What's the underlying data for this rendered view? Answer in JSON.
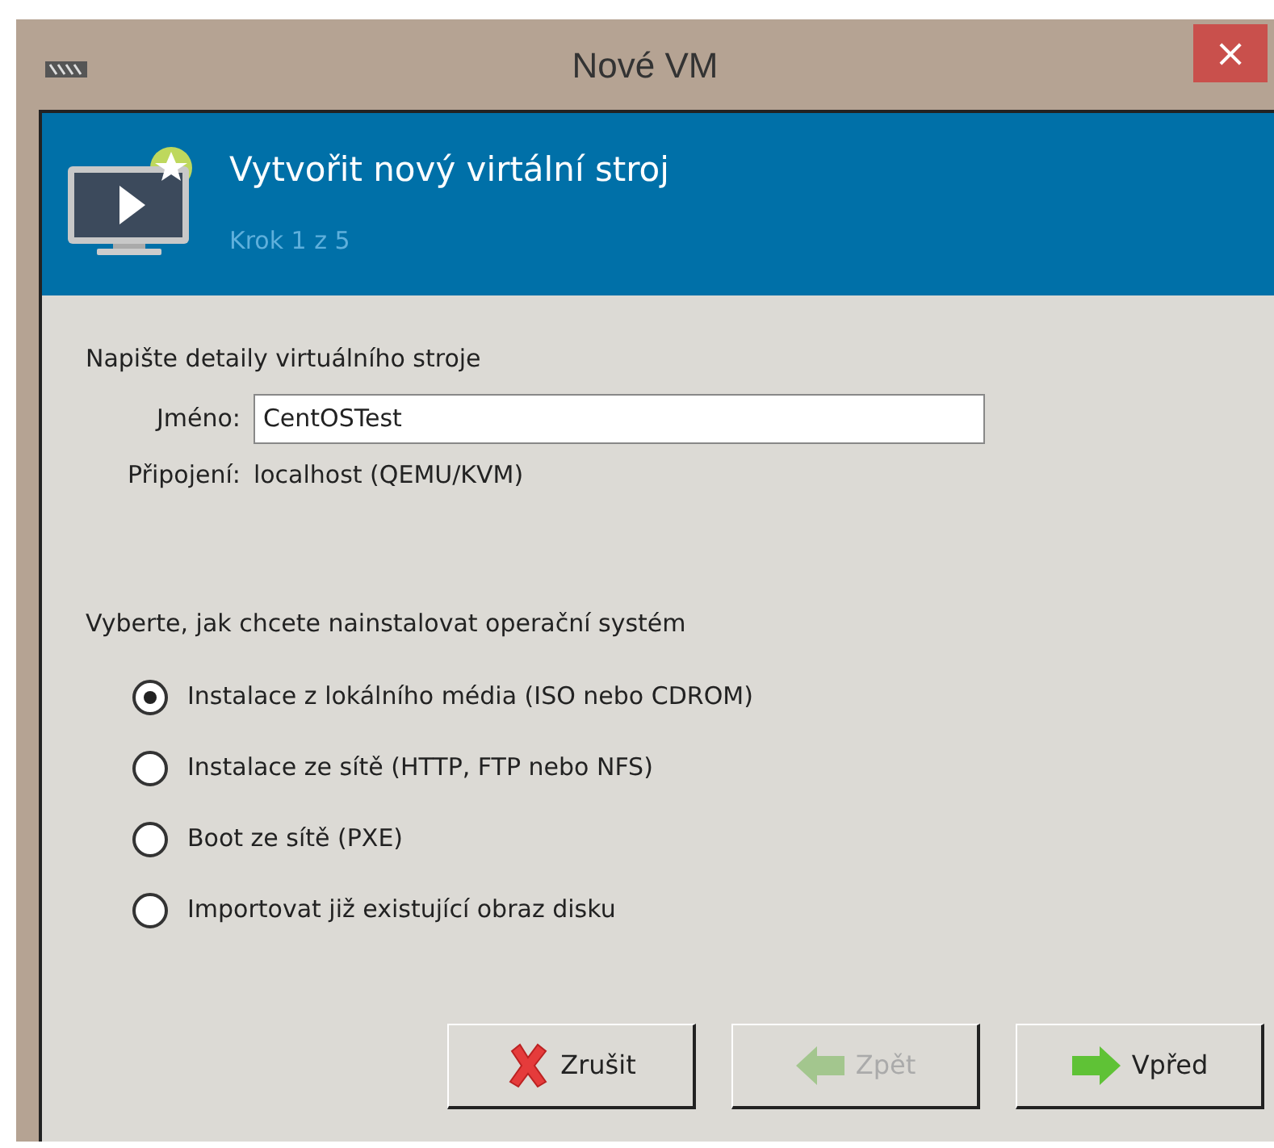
{
  "window": {
    "title": "Nové VM",
    "close": "×"
  },
  "header": {
    "title": "Vytvořit nový virtální stroj",
    "step": "Krok 1 z 5"
  },
  "details": {
    "heading": "Napište detaily virtuálního stroje",
    "name_label": "Jméno:",
    "name_value": "CentOSTest",
    "connection_label": "Připojení:",
    "connection_value": "localhost (QEMU/KVM)"
  },
  "install": {
    "heading": "Vyberte, jak chcete nainstalovat operační systém",
    "options": [
      {
        "label": "Instalace z lokálního média (ISO nebo CDROM)",
        "selected": true
      },
      {
        "label": "Instalace ze sítě (HTTP, FTP nebo NFS)",
        "selected": false
      },
      {
        "label": "Boot ze sítě (PXE)",
        "selected": false
      },
      {
        "label": "Importovat již existující obraz disku",
        "selected": false
      }
    ]
  },
  "buttons": [
    {
      "kind": "cancel",
      "label": "Zrušit",
      "disabled": false
    },
    {
      "kind": "back",
      "label": "Zpět",
      "disabled": true
    },
    {
      "kind": "forward",
      "label": "Vpřed",
      "disabled": false
    }
  ]
}
